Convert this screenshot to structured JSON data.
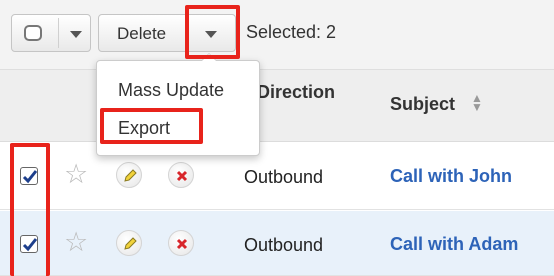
{
  "toolbar": {
    "delete_label": "Delete",
    "selected_label": "Selected: 2"
  },
  "menu": {
    "items": [
      {
        "label": "Mass Update"
      },
      {
        "label": "Export"
      }
    ]
  },
  "table": {
    "headers": {
      "direction": "Direction",
      "subject": "Subject"
    },
    "rows": [
      {
        "checked": true,
        "direction": "Outbound",
        "subject": "Call with John"
      },
      {
        "checked": true,
        "direction": "Outbound",
        "subject": "Call with Adam"
      }
    ]
  },
  "colors": {
    "highlight": "#e8231b",
    "link": "#2d63b8",
    "selected_row": "#e8f1fa"
  },
  "icons": [
    "checkbox-icon",
    "chevron-down-icon",
    "star-icon",
    "pencil-icon",
    "close-icon",
    "sort-icon"
  ]
}
